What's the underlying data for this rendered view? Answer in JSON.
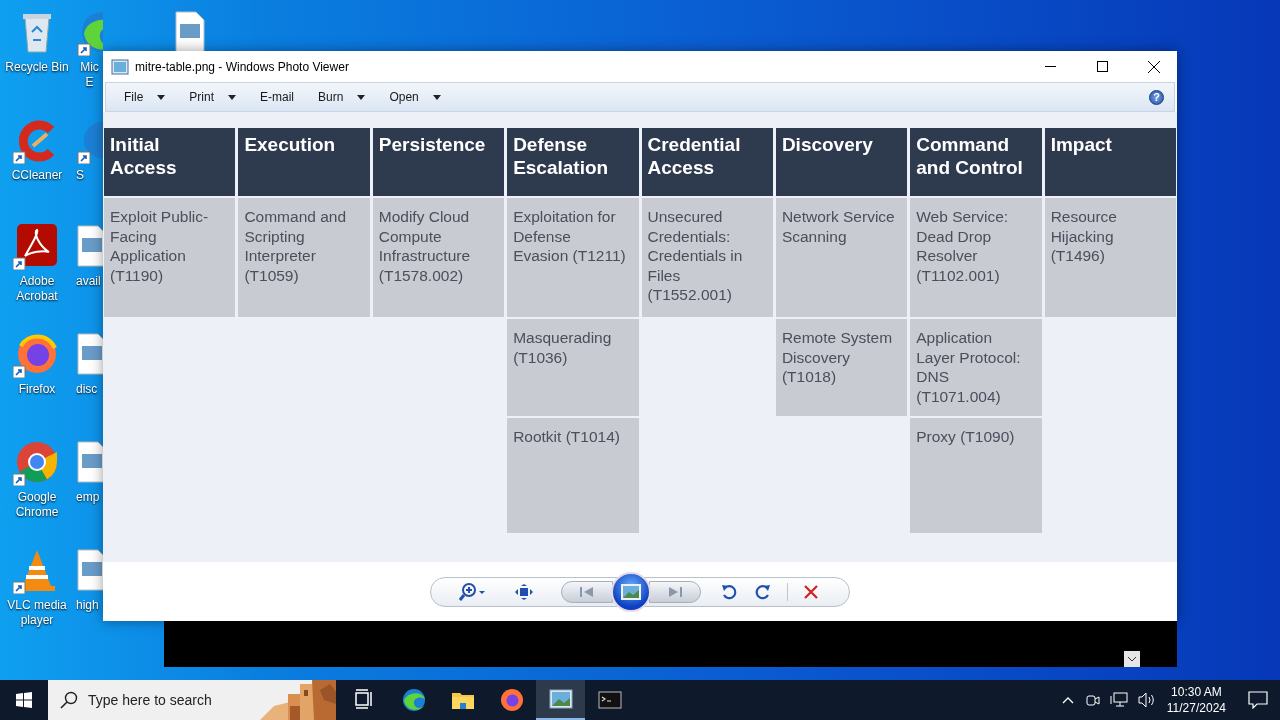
{
  "desktop": {
    "icons": [
      {
        "kind": "recycle-bin",
        "lines": [
          "Recycle Bin"
        ],
        "shortcut": false
      },
      {
        "kind": "ccleaner",
        "lines": [
          "CCleaner"
        ],
        "shortcut": true
      },
      {
        "kind": "acrobat",
        "lines": [
          "Adobe",
          "Acrobat"
        ],
        "shortcut": true
      },
      {
        "kind": "firefox",
        "lines": [
          "Firefox"
        ],
        "shortcut": true
      },
      {
        "kind": "chrome",
        "lines": [
          "Google",
          "Chrome"
        ],
        "shortcut": true
      },
      {
        "kind": "vlc",
        "lines": [
          "VLC media",
          "player"
        ],
        "shortcut": true
      }
    ],
    "partial_icons": [
      {
        "kind": "edge",
        "lines": [
          "Mic",
          "E"
        ],
        "shortcut": true
      },
      {
        "kind": "app",
        "lines": [
          "S"
        ],
        "shortcut": true
      },
      {
        "kind": "file",
        "lines": [
          "avail"
        ],
        "shortcut": false
      },
      {
        "kind": "file",
        "lines": [
          "disc"
        ],
        "shortcut": false
      },
      {
        "kind": "file",
        "lines": [
          "emp"
        ],
        "shortcut": false
      },
      {
        "kind": "file",
        "lines": [
          "high"
        ],
        "shortcut": false
      }
    ]
  },
  "window": {
    "title": "mitre-table.png - Windows Photo Viewer",
    "menu": [
      {
        "label": "File",
        "dropdown": true
      },
      {
        "label": "Print",
        "dropdown": true
      },
      {
        "label": "E-mail",
        "dropdown": false
      },
      {
        "label": "Burn",
        "dropdown": true
      },
      {
        "label": "Open",
        "dropdown": true
      }
    ],
    "help": "?",
    "table": {
      "columns": [
        {
          "header": "Initial Access",
          "techniques": [
            "Exploit Public-Facing Application (T1190)"
          ]
        },
        {
          "header": "Execution",
          "techniques": [
            "Command and Scripting Interpreter (T1059)"
          ]
        },
        {
          "header": "Persistence",
          "techniques": [
            "Modify Cloud Compute Infrastructure (T1578.002)"
          ]
        },
        {
          "header": "Defense Escalation",
          "techniques": [
            "Exploitation for Defense Evasion (T1211)",
            "Masquerading (T1036)",
            "Rootkit (T1014)"
          ]
        },
        {
          "header": "Credential Access",
          "techniques": [
            "Unsecured Credentials: Credentials in Files (T1552.001)"
          ]
        },
        {
          "header": "Discovery",
          "techniques": [
            "Network Service Scanning",
            "Remote System Discovery (T1018)"
          ]
        },
        {
          "header": "Command and Control",
          "techniques": [
            "Web Service: Dead Drop Resolver (T1102.001)",
            "Application Layer Protocol: DNS (T1071.004)",
            "Proxy (T1090)"
          ]
        },
        {
          "header": "Impact",
          "techniques": [
            "Resource Hijacking (T1496)"
          ]
        }
      ]
    }
  },
  "taskbar": {
    "search": {
      "placeholder": "Type here to search"
    },
    "apps": [
      {
        "kind": "task-view",
        "active": false
      },
      {
        "kind": "edge",
        "active": false
      },
      {
        "kind": "explorer",
        "active": false
      },
      {
        "kind": "firefox",
        "active": false
      },
      {
        "kind": "photos",
        "active": true
      },
      {
        "kind": "terminal",
        "active": false
      }
    ],
    "time": "10:30 AM",
    "date": "11/27/2024"
  }
}
